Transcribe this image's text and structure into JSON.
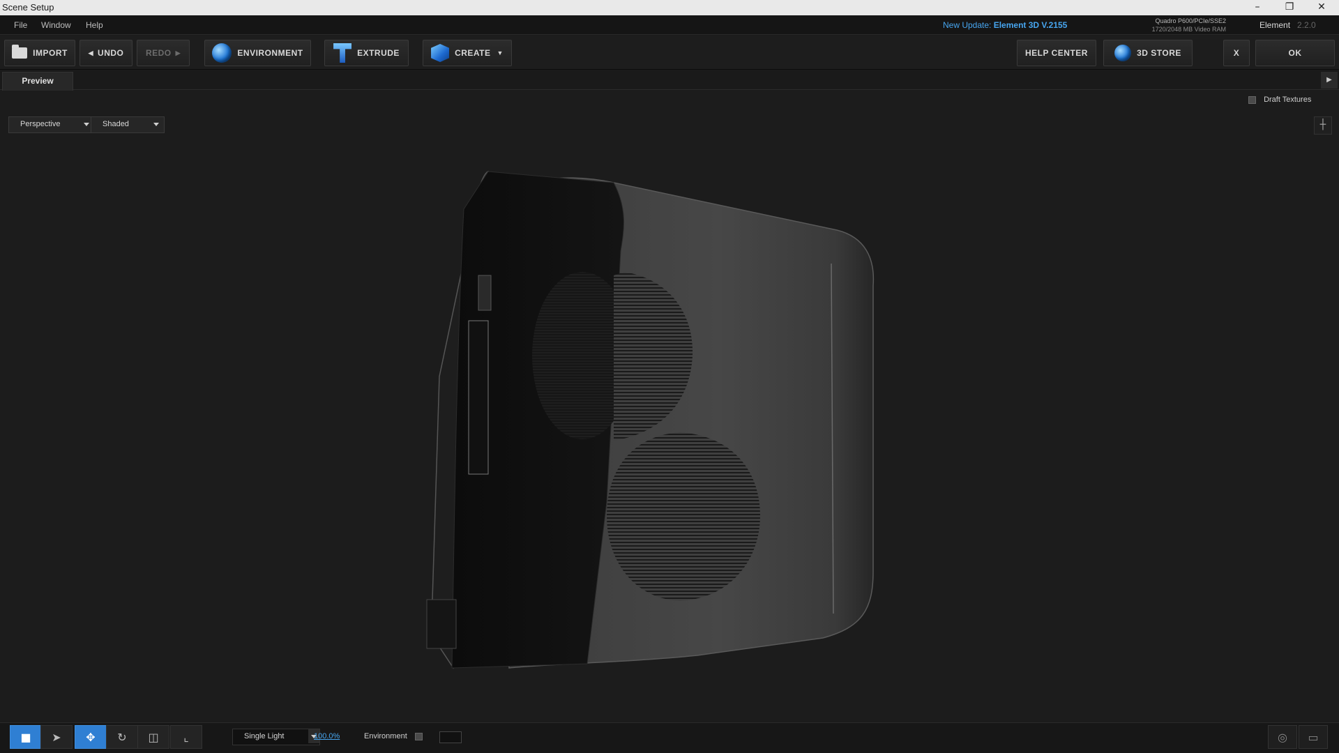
{
  "window": {
    "title": "Scene Setup",
    "minimize": "–",
    "restore": "❐",
    "close": "✕"
  },
  "menu": {
    "items": [
      "File",
      "Window",
      "Help"
    ]
  },
  "update": {
    "label": "New Update:",
    "value": "Element 3D V.2155"
  },
  "gpu": {
    "line1": "Quadro P600/PCIe/SSE2",
    "line2": "1720/2048 MB Video RAM"
  },
  "plugin": {
    "name": "Element",
    "version": "2.2.0"
  },
  "toolbar": {
    "import": "IMPORT",
    "undo": "UNDO",
    "redo": "REDO",
    "environment": "ENVIRONMENT",
    "extrude": "EXTRUDE",
    "create": "CREATE",
    "help_center": "HELP CENTER",
    "store": "3D STORE",
    "close": "X",
    "ok": "OK"
  },
  "tabs": {
    "preview": "Preview"
  },
  "viewport": {
    "draft_textures": "Draft Textures",
    "camera_view": "Perspective",
    "render_mode": "Shaded"
  },
  "bottom": {
    "lighting": "Single Light",
    "intensity": "100.0%",
    "environment": "Environment"
  },
  "icons": [
    "camera-icon",
    "select-arrow-icon",
    "move-icon",
    "rotate-icon",
    "scale-icon",
    "axis-icon",
    "target-icon",
    "monitor-icon",
    "globe-icon",
    "cube-icon",
    "extrude-icon",
    "folder-icon"
  ]
}
